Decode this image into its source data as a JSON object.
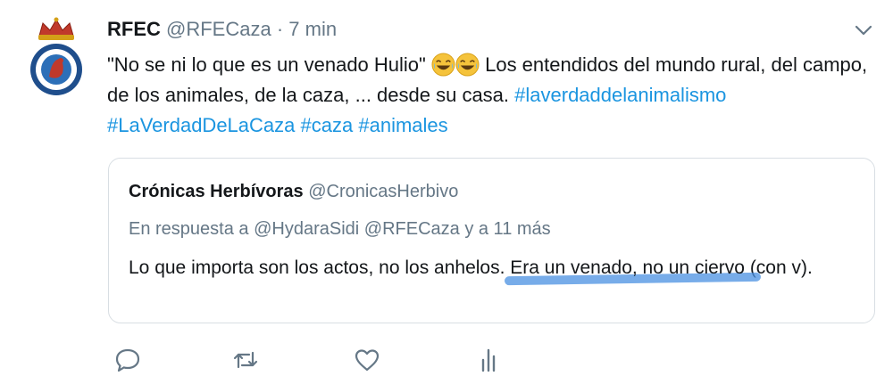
{
  "tweet": {
    "author_name": "RFEC",
    "author_handle": "@RFECaza",
    "separator": "·",
    "time": "7 min",
    "text_start": "\"No se ni lo que es un venado Hulio\"",
    "text_rest": " Los entendidos del mundo rural, del campo, de los animales, de la caza, ... desde su casa. ",
    "hashtags": [
      "#laverdaddelanimalismo",
      "#LaVerdadDeLaCaza",
      "#caza",
      "#animales"
    ],
    "emojis": [
      "joy-emoji",
      "joy-emoji"
    ]
  },
  "quoted": {
    "author_name": "Crónicas Herbívoras",
    "author_handle": "@CronicasHerbivo",
    "reply_line": "En respuesta a @HydaraSidi @RFECaza y a 11 más",
    "text_before": "Lo que importa son los actos, no los anhelos.",
    "text_highlighted": "Era un venado, no un ciervo",
    "text_after": "(con v)."
  },
  "actions": {
    "icons": [
      "reply-icon",
      "retweet-icon",
      "like-icon",
      "analytics-icon"
    ]
  },
  "colors": {
    "link": "#1b95e0",
    "muted": "#657786",
    "text": "#14171a",
    "highlight": "#4a90e2"
  }
}
